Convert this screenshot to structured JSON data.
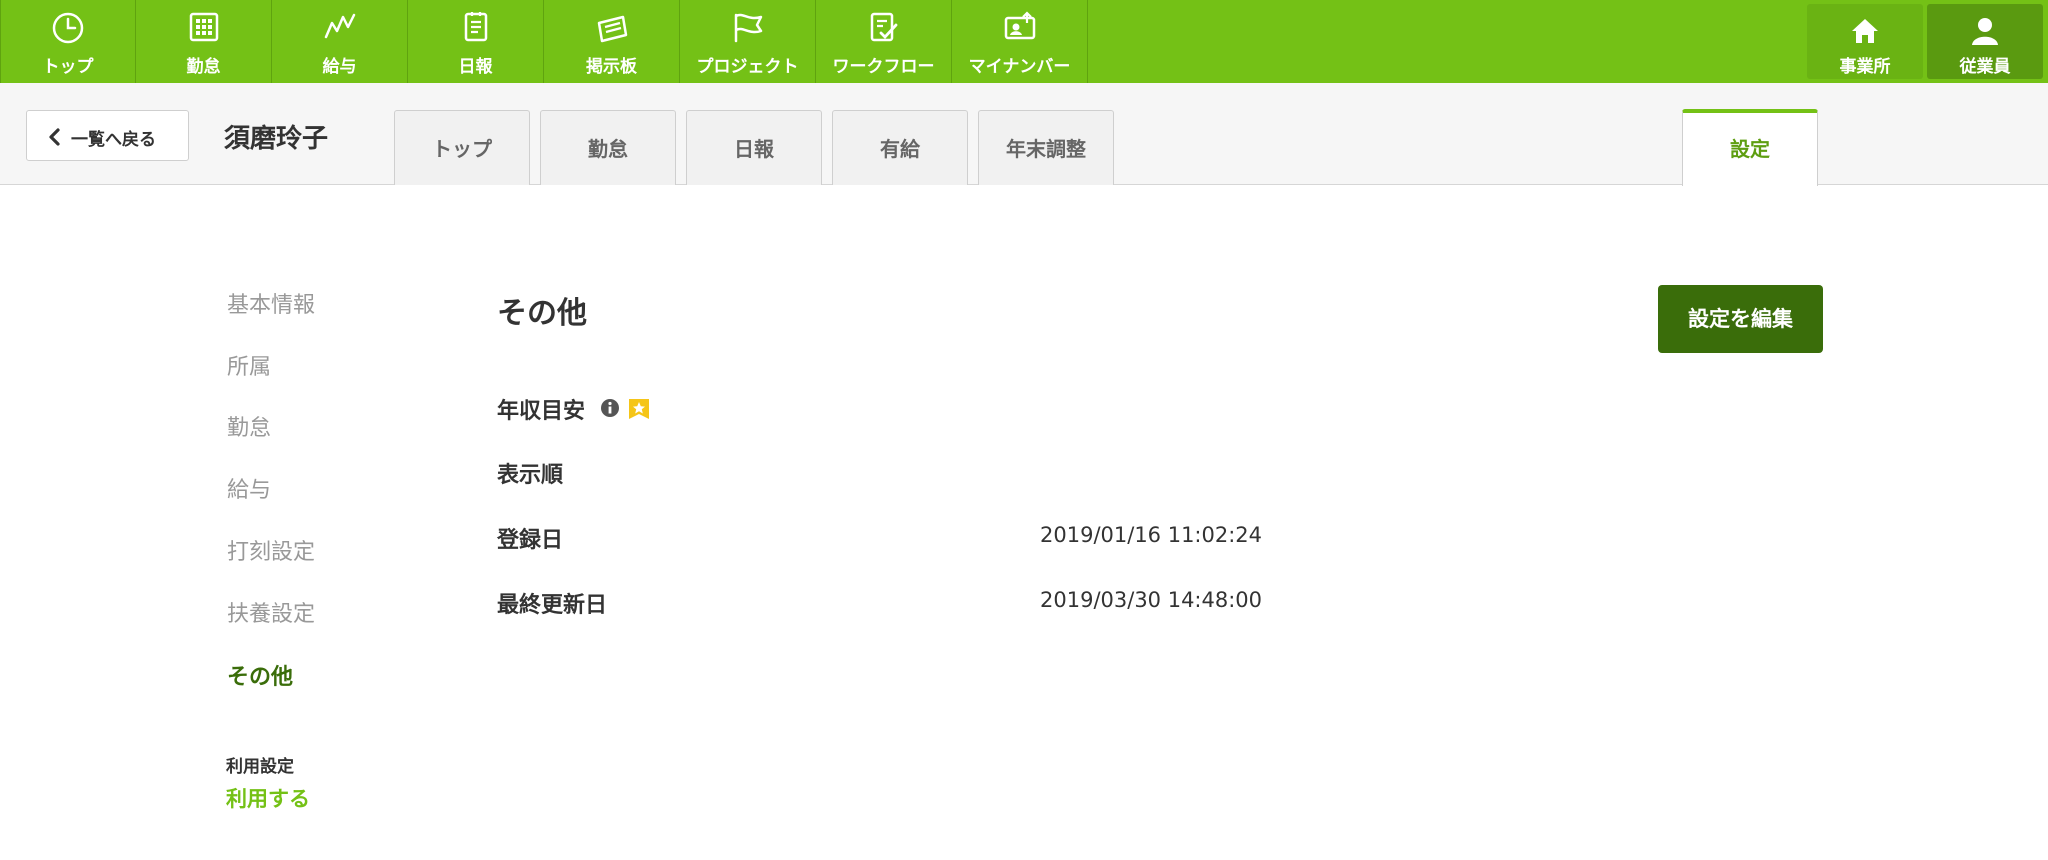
{
  "topnav": {
    "items": [
      {
        "label": "トップ",
        "icon": "clock-icon"
      },
      {
        "label": "勤怠",
        "icon": "calendar-grid-icon"
      },
      {
        "label": "給与",
        "icon": "chart-line-icon"
      },
      {
        "label": "日報",
        "icon": "notepad-icon"
      },
      {
        "label": "掲示板",
        "icon": "board-icon"
      },
      {
        "label": "プロジェクト",
        "icon": "flag-icon"
      },
      {
        "label": "ワークフロー",
        "icon": "checklist-icon"
      },
      {
        "label": "マイナンバー",
        "icon": "id-card-icon"
      }
    ],
    "office_label": "事業所",
    "employee_label": "従業員"
  },
  "subheader": {
    "back_label": "一覧へ戻る",
    "employee_name": "須磨玲子",
    "tabs": [
      {
        "label": "トップ"
      },
      {
        "label": "勤怠"
      },
      {
        "label": "日報"
      },
      {
        "label": "有給"
      },
      {
        "label": "年末調整"
      }
    ],
    "settings_tab": "設定"
  },
  "sidemenu": {
    "items": [
      {
        "label": "基本情報"
      },
      {
        "label": "所属"
      },
      {
        "label": "勤怠"
      },
      {
        "label": "給与"
      },
      {
        "label": "打刻設定"
      },
      {
        "label": "扶養設定"
      },
      {
        "label": "その他"
      }
    ],
    "usage_label": "利用設定",
    "usage_value": "利用する"
  },
  "main": {
    "section_title": "その他",
    "edit_button": "設定を編集",
    "fields": [
      {
        "label": "年収目安",
        "value": ""
      },
      {
        "label": "表示順",
        "value": ""
      },
      {
        "label": "登録日",
        "value": "2019/01/16 11:02:24"
      },
      {
        "label": "最終更新日",
        "value": "2019/03/30 14:48:00"
      }
    ]
  },
  "colors": {
    "brand_green": "#74c116",
    "dark_green": "#3a6d0a",
    "star_yellow": "#f5c518"
  }
}
